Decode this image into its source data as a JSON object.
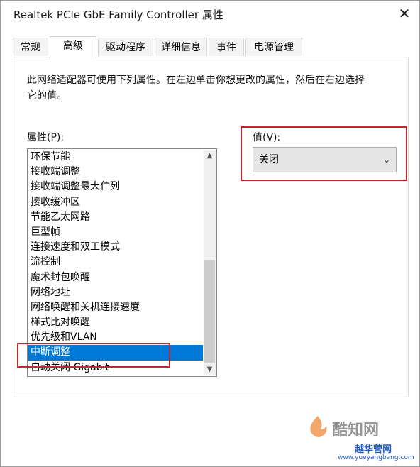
{
  "window": {
    "title": "Realtek PCIe GbE Family Controller 属性",
    "close": "✕"
  },
  "tabs": [
    {
      "label": "常规"
    },
    {
      "label": "高级"
    },
    {
      "label": "驱动程序"
    },
    {
      "label": "详细信息"
    },
    {
      "label": "事件"
    },
    {
      "label": "电源管理"
    }
  ],
  "active_tab": "高级",
  "description": "此网络适配器可使用下列属性。在左边单击你想更改的属性，然后在右边选择它的值。",
  "property_label": "属性(P):",
  "value_label": "值(V):",
  "properties": [
    {
      "label": "环保节能"
    },
    {
      "label": "接收端调整"
    },
    {
      "label": "接收端调整最大伫列"
    },
    {
      "label": "接收缓冲区"
    },
    {
      "label": "节能乙太网路"
    },
    {
      "label": "巨型帧"
    },
    {
      "label": "连接速度和双工模式"
    },
    {
      "label": "流控制"
    },
    {
      "label": "魔术封包唤醒"
    },
    {
      "label": "网络地址"
    },
    {
      "label": "网络唤醒和关机连接速度"
    },
    {
      "label": "样式比对唤醒"
    },
    {
      "label": "优先级和VLAN"
    },
    {
      "label": "中断调整"
    },
    {
      "label": "自动关闭 Gigabit"
    }
  ],
  "selected_property": "中断调整",
  "value_dropdown": {
    "value": "关闭",
    "arrow": "⌄"
  },
  "scrollbar": {
    "up": "▲",
    "down": "▼"
  },
  "watermark": {
    "brand": "酷知网",
    "site_name": "越华营网",
    "site_url": "www.yueyangbang.com"
  },
  "colors": {
    "selection": "#0078d7",
    "highlight_box": "#c0282d"
  }
}
